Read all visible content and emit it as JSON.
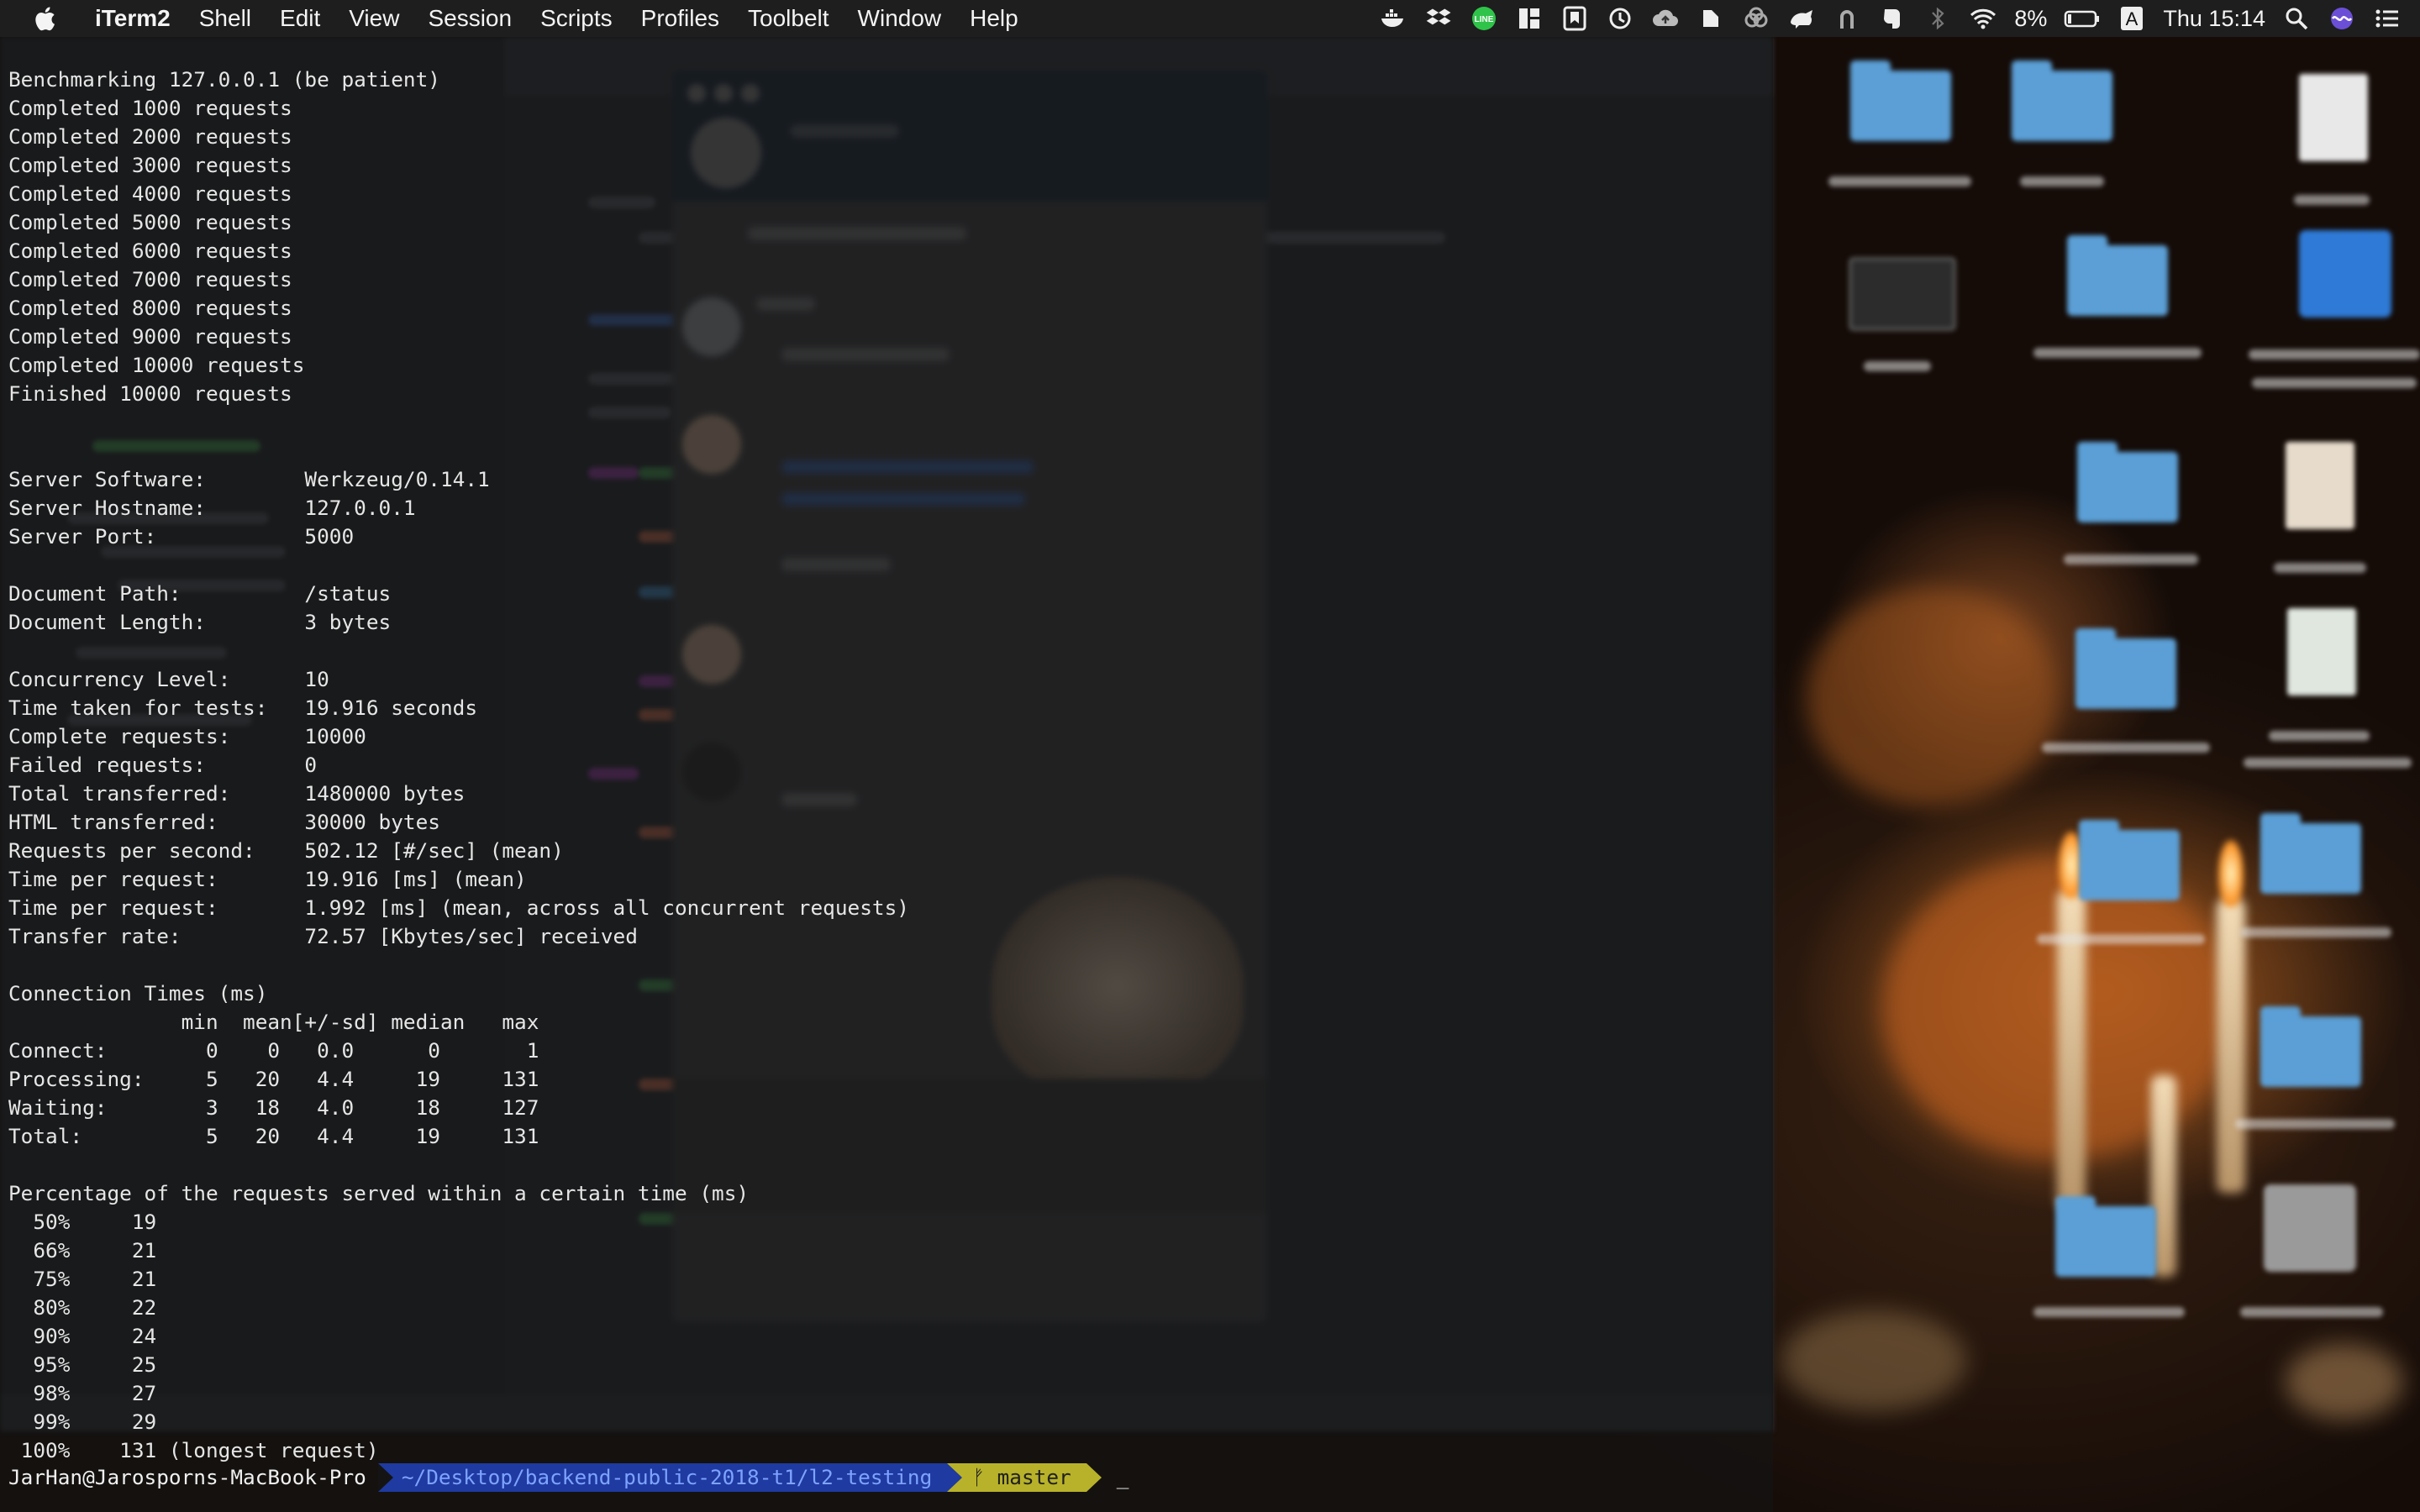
{
  "menubar": {
    "app_name": "iTerm2",
    "menus": [
      "Shell",
      "Edit",
      "View",
      "Session",
      "Scripts",
      "Profiles",
      "Toolbelt",
      "Window",
      "Help"
    ],
    "battery": "8%",
    "input_source": "A",
    "clock": "Thu 15:14",
    "status_icons": [
      "docker-icon",
      "dropbox-icon",
      "line-icon",
      "tiles-icon",
      "bookmark-icon",
      "time-machine-icon",
      "cloud-upload-icon",
      "evernote-icon",
      "creative-cloud-icon",
      "mastodon-icon",
      "vpn-lock-icon",
      "evernote-elephant-icon",
      "bluetooth-icon",
      "wifi-icon",
      "battery-icon",
      "search-icon",
      "siri-icon",
      "notification-center-icon"
    ]
  },
  "terminal": {
    "output": "Benchmarking 127.0.0.1 (be patient)\nCompleted 1000 requests\nCompleted 2000 requests\nCompleted 3000 requests\nCompleted 4000 requests\nCompleted 5000 requests\nCompleted 6000 requests\nCompleted 7000 requests\nCompleted 8000 requests\nCompleted 9000 requests\nCompleted 10000 requests\nFinished 10000 requests\n\n\nServer Software:        Werkzeug/0.14.1\nServer Hostname:        127.0.0.1\nServer Port:            5000\n\nDocument Path:          /status\nDocument Length:        3 bytes\n\nConcurrency Level:      10\nTime taken for tests:   19.916 seconds\nComplete requests:      10000\nFailed requests:        0\nTotal transferred:      1480000 bytes\nHTML transferred:       30000 bytes\nRequests per second:    502.12 [#/sec] (mean)\nTime per request:       19.916 [ms] (mean)\nTime per request:       1.992 [ms] (mean, across all concurrent requests)\nTransfer rate:          72.57 [Kbytes/sec] received\n\nConnection Times (ms)\n              min  mean[+/-sd] median   max\nConnect:        0    0   0.0      0       1\nProcessing:     5   20   4.4     19     131\nWaiting:        3   18   4.0     18     127\nTotal:          5   20   4.4     19     131\n\nPercentage of the requests served within a certain time (ms)\n  50%     19\n  66%     21\n  75%     21\n  80%     22\n  90%     24\n  95%     25\n  98%     27\n  99%     29\n 100%    131 (longest request)",
    "prompt": {
      "user_host": "JarHan@Jarosporns-MacBook-Pro",
      "path": "~/Desktop/backend-public-2018-t1/l2-testing",
      "branch_symbol": "ᚠ",
      "branch": "master",
      "cursor": "_"
    }
  },
  "colors": {
    "menubar_bg": "#1e1e1e",
    "terminal_text": "#e6e6e6",
    "prompt_path_bg": "#1f3aa0",
    "prompt_git_bg": "#b8b22a"
  }
}
